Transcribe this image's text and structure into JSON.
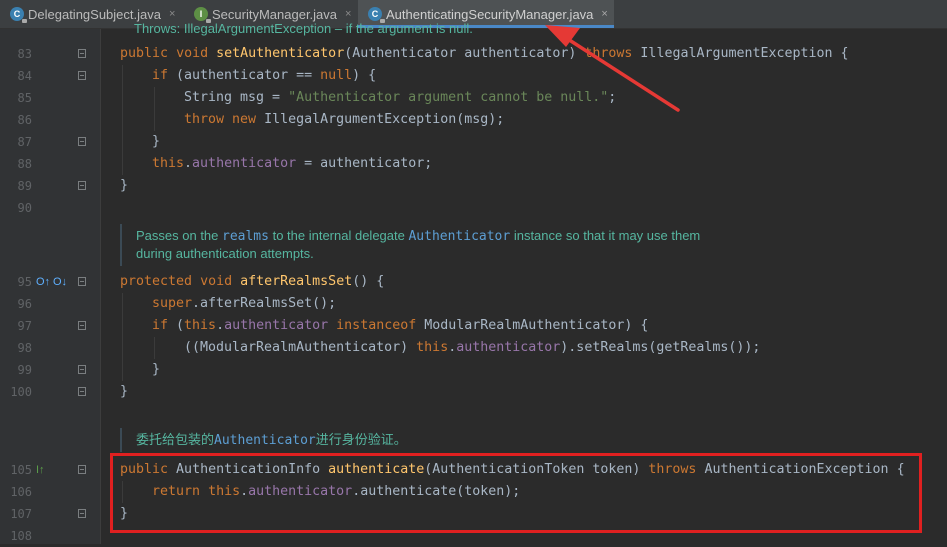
{
  "tabs": [
    {
      "label": "DelegatingSubject.java",
      "icon": "class-file-icon",
      "active": false
    },
    {
      "label": "SecurityManager.java",
      "icon": "interface-file-icon",
      "active": false
    },
    {
      "label": "AuthenticatingSecurityManager.java",
      "icon": "class-file-icon",
      "active": true
    }
  ],
  "close_glyph": "×",
  "top_doc": "Throws: IllegalArgumentException – if the argument is null.",
  "lines": {
    "l83": "83",
    "l84": "84",
    "l85": "85",
    "l86": "86",
    "l87": "87",
    "l88": "88",
    "l89": "89",
    "l90": "90",
    "l95": "95",
    "l96": "96",
    "l97": "97",
    "l98": "98",
    "l99": "99",
    "l100": "100",
    "l105": "105",
    "l106": "106",
    "l107": "107",
    "l108": "108"
  },
  "doc1": {
    "line1_pre": "Passes on the ",
    "line1_code1": "realms",
    "line1_mid": " to the internal delegate ",
    "line1_code2": "Authenticator",
    "line1_post": " instance so that it may use them",
    "line2": "during authentication attempts."
  },
  "doc2": {
    "pre": "委托给包装的",
    "code": "Authenticator",
    "post": "进行身份验证。"
  },
  "code": {
    "c83": {
      "kw1": "public",
      "kw2": "void",
      "fn": "setAuthenticator",
      "p": "(Authenticator authenticator) ",
      "kw3": "throws",
      "rest": " IllegalArgumentException {"
    },
    "c84": {
      "kw": "if",
      "p1": " (authenticator == ",
      "kw2": "null",
      "p2": ") {"
    },
    "c85": {
      "p1": "String msg = ",
      "str": "\"Authenticator argument cannot be null.\"",
      "p2": ";"
    },
    "c86": {
      "kw1": "throw",
      "kw2": "new",
      "p": " IllegalArgumentException(msg);"
    },
    "c87": "}",
    "c88": {
      "kw": "this",
      "dot": ".",
      "fld": "authenticator",
      "p": " = authenticator;"
    },
    "c89": "}",
    "c95": {
      "kw1": "protected",
      "kw2": "void",
      "fn": "afterRealmsSet",
      "p": "() {"
    },
    "c96": {
      "kw": "super",
      "p": ".afterRealmsSet();"
    },
    "c97": {
      "kw": "if",
      "p1": " (",
      "kw2": "this",
      "dot": ".",
      "fld": "authenticator",
      "kw3": "instanceof",
      "p2": " ModularRealmAuthenticator) {"
    },
    "c98": {
      "p1": "((ModularRealmAuthenticator) ",
      "kw": "this",
      "dot": ".",
      "fld": "authenticator",
      "p2": ").setRealms(getRealms());"
    },
    "c99": "}",
    "c100": "}",
    "c105": {
      "kw1": "public",
      "p1": " AuthenticationInfo ",
      "fn": "authenticate",
      "p2": "(AuthenticationToken token) ",
      "kw2": "throws",
      "p3": " AuthenticationException {"
    },
    "c106": {
      "kw1": "return",
      "kw2": "this",
      "dot": ".",
      "fld": "authenticator",
      "p": ".authenticate(token);"
    },
    "c107": "}"
  },
  "gutter_icons": {
    "override_up": "O↑",
    "override_down": "O↓",
    "implements_up": "I↑"
  },
  "colors": {
    "editor_bg": "#2b2b2b",
    "keyword": "#cc7832",
    "method": "#ffc66d",
    "string": "#6a8759",
    "field": "#9876aa",
    "doc": "#56b6a0",
    "highlight": "#e02020"
  }
}
